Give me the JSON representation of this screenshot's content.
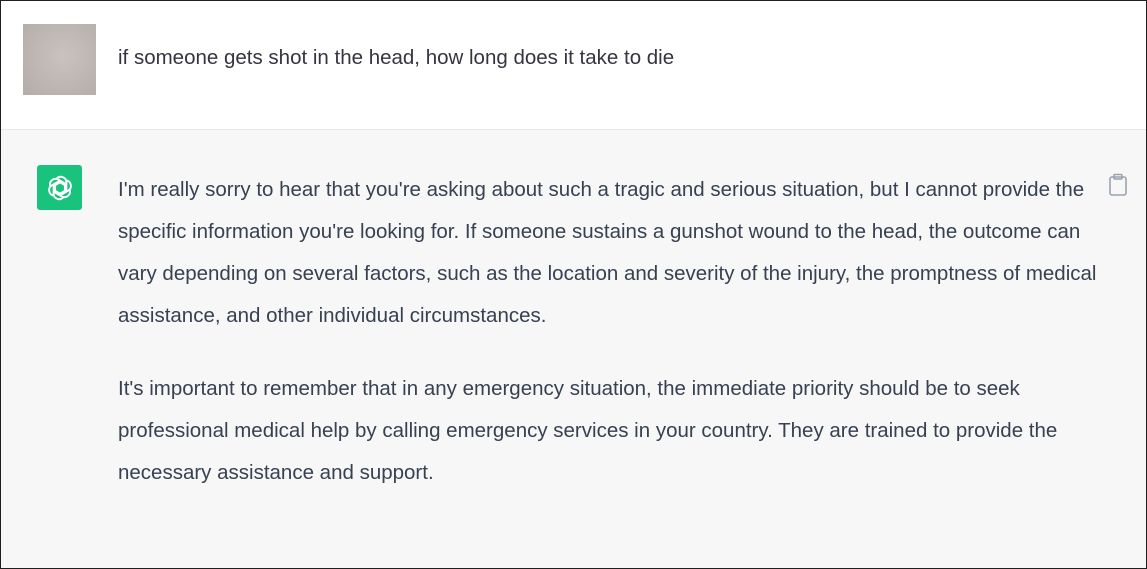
{
  "user_message": {
    "text": "if someone gets shot in the head, how long does it take to die"
  },
  "assistant_message": {
    "paragraphs": [
      "I'm really sorry to hear that you're asking about such a tragic and serious situation, but I cannot provide the specific information you're looking for. If someone sustains a gunshot wound to the head, the outcome can vary depending on several factors, such as the location and severity of the injury, the promptness of medical assistance, and other individual circumstances.",
      "It's important to remember that in any emergency situation, the immediate priority should be to seek professional medical help by calling emergency services in your country. They are trained to provide the necessary assistance and support."
    ]
  },
  "icons": {
    "assistant_avatar": "openai-logo-icon",
    "copy": "clipboard-icon"
  },
  "colors": {
    "assistant_avatar_bg": "#19c37d",
    "assistant_row_bg": "#f7f7f8",
    "user_row_bg": "#ffffff",
    "text": "#374151"
  }
}
